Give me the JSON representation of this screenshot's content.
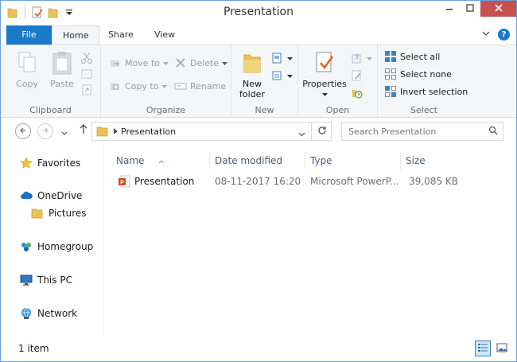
{
  "window": {
    "title": "Presentation"
  },
  "ribbon_tabs": {
    "file": "File",
    "home": "Home",
    "share": "Share",
    "view": "View"
  },
  "ribbon": {
    "clipboard": {
      "copy": "Copy",
      "paste": "Paste",
      "label": "Clipboard"
    },
    "organize": {
      "move_to": "Move to",
      "copy_to": "Copy to",
      "delete": "Delete",
      "rename": "Rename",
      "label": "Organize"
    },
    "new": {
      "new_folder_line1": "New",
      "new_folder_line2": "folder",
      "label": "New"
    },
    "open": {
      "properties": "Properties",
      "label": "Open"
    },
    "select": {
      "select_all": "Select all",
      "select_none": "Select none",
      "invert_selection": "Invert selection",
      "label": "Select"
    }
  },
  "address": {
    "crumb": "Presentation",
    "search_placeholder": "Search Presentation"
  },
  "navpane": {
    "favorites": "Favorites",
    "onedrive": "OneDrive",
    "pictures": "Pictures",
    "homegroup": "Homegroup",
    "this_pc": "This PC",
    "network": "Network"
  },
  "columns": {
    "name": "Name",
    "date_modified": "Date modified",
    "type": "Type",
    "size": "Size"
  },
  "files": [
    {
      "name": "Presentation",
      "date_modified": "08-11-2017 16:20",
      "type": "Microsoft PowerP...",
      "size": "39,085 KB"
    }
  ],
  "status": {
    "item_count": "1 item"
  },
  "colors": {
    "accent": "#1979ca",
    "close": "#c75050",
    "folder": "#e8c25a",
    "powerpoint": "#d24726"
  },
  "icons": [
    "folder-icon",
    "properties-icon",
    "chevron-down-icon",
    "minimize-icon",
    "maximize-icon",
    "close-icon",
    "help-icon",
    "back-icon",
    "forward-icon",
    "up-icon",
    "refresh-icon",
    "search-icon",
    "star-icon",
    "cloud-icon",
    "homegroup-icon",
    "computer-icon",
    "network-icon",
    "powerpoint-file-icon",
    "details-view-icon",
    "large-icons-view-icon"
  ]
}
